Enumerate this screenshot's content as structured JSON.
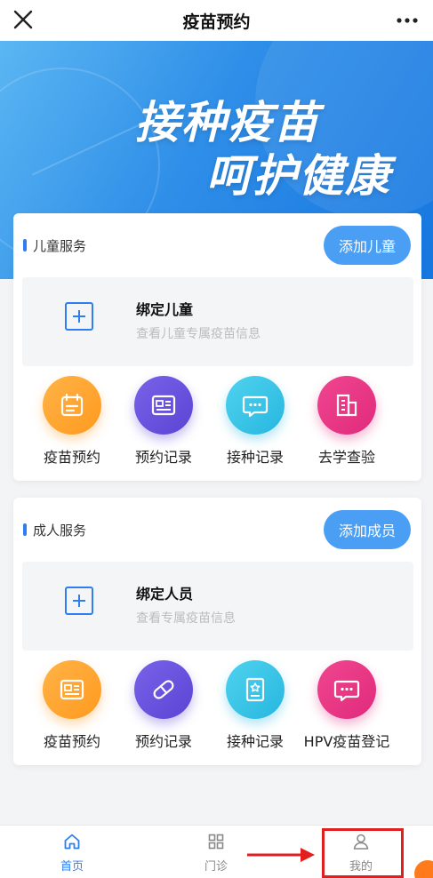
{
  "titlebar": {
    "title": "疫苗预约"
  },
  "banner": {
    "slogan_line1": "接种疫苗",
    "slogan_line2": "呵护健康"
  },
  "child_section": {
    "label": "儿童服务",
    "add_button": "添加儿童",
    "bind": {
      "title": "绑定儿童",
      "subtitle": "查看儿童专属疫苗信息"
    },
    "services": [
      {
        "label": "疫苗预约",
        "icon": "calendar-icon",
        "color": "#ffa533"
      },
      {
        "label": "预约记录",
        "icon": "list-card-icon",
        "color": "#6a52de"
      },
      {
        "label": "接种记录",
        "icon": "chat-bubble-icon",
        "color": "#3cc5e8"
      },
      {
        "label": "去学查验",
        "icon": "building-icon",
        "color": "#e8378a"
      }
    ]
  },
  "adult_section": {
    "label": "成人服务",
    "add_button": "添加成员",
    "bind": {
      "title": "绑定人员",
      "subtitle": "查看专属疫苗信息"
    },
    "services": [
      {
        "label": "疫苗预约",
        "icon": "list-card-icon",
        "color": "#ffa533"
      },
      {
        "label": "预约记录",
        "icon": "capsule-icon",
        "color": "#6a52de"
      },
      {
        "label": "接种记录",
        "icon": "certificate-icon",
        "color": "#3cc5e8"
      },
      {
        "label": "HPV疫苗登记",
        "icon": "chat-bubble-icon",
        "color": "#e8378a"
      }
    ]
  },
  "tabbar": {
    "tabs": [
      {
        "label": "首页",
        "icon": "home-icon",
        "active": true
      },
      {
        "label": "门诊",
        "icon": "grid-icon",
        "active": false
      },
      {
        "label": "我的",
        "icon": "user-icon",
        "active": false
      }
    ]
  },
  "colors": {
    "accent": "#2f7ef0",
    "highlight": "#e21f1f"
  }
}
